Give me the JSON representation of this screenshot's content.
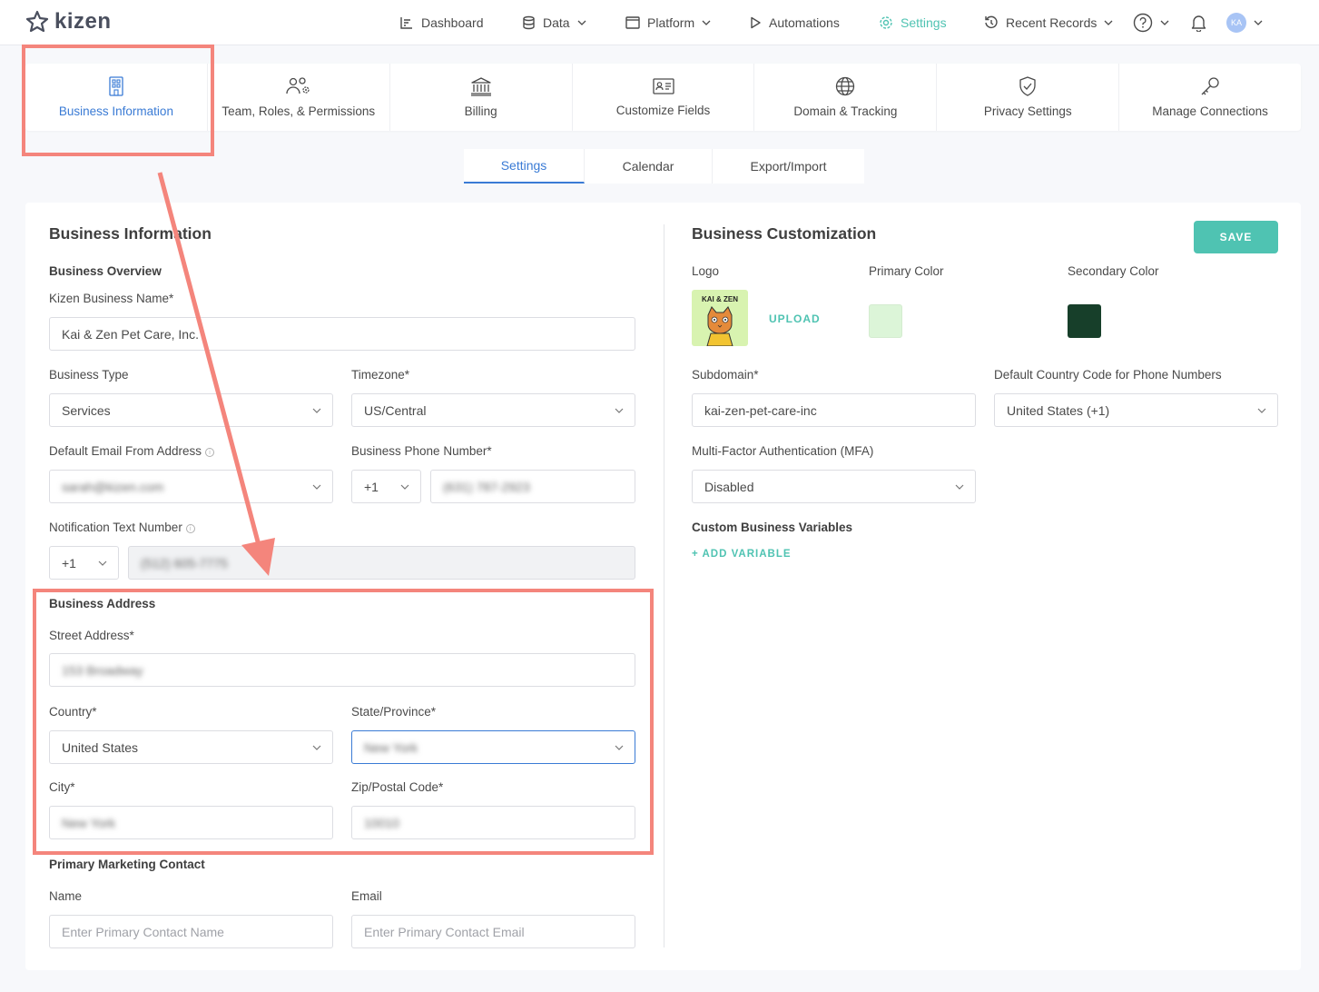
{
  "app": {
    "name": "kizen"
  },
  "topnav": {
    "items": [
      {
        "label": "Dashboard"
      },
      {
        "label": "Data"
      },
      {
        "label": "Platform"
      },
      {
        "label": "Automations"
      },
      {
        "label": "Settings"
      },
      {
        "label": "Recent Records"
      }
    ],
    "avatar_initials": "KA"
  },
  "tiles": [
    {
      "label": "Business Information",
      "icon": "building-icon"
    },
    {
      "label": "Team, Roles, & Permissions",
      "icon": "users-gear-icon"
    },
    {
      "label": "Billing",
      "icon": "bank-icon"
    },
    {
      "label": "Customize Fields",
      "icon": "id-card-icon"
    },
    {
      "label": "Domain & Tracking",
      "icon": "globe-icon"
    },
    {
      "label": "Privacy Settings",
      "icon": "shield-check-icon"
    },
    {
      "label": "Manage Connections",
      "icon": "key-icon"
    }
  ],
  "subtabs": [
    {
      "label": "Settings"
    },
    {
      "label": "Calendar"
    },
    {
      "label": "Export/Import"
    }
  ],
  "left": {
    "title": "Business Information",
    "overview_heading": "Business Overview",
    "business_name_label": "Kizen Business Name*",
    "business_name_value": "Kai & Zen Pet Care, Inc.",
    "business_type_label": "Business Type",
    "business_type_value": "Services",
    "timezone_label": "Timezone*",
    "timezone_value": "US/Central",
    "email_from_label": "Default Email From Address",
    "email_from_value": "sarah@kizen.com",
    "phone_label": "Business Phone Number*",
    "phone_code": "+1",
    "phone_value": "(631) 787-2923",
    "notif_label": "Notification Text Number",
    "notif_code": "+1",
    "notif_value": "(512) 605-7775",
    "address_heading": "Business Address",
    "street_label": "Street Address*",
    "street_value": "153 Broadway",
    "country_label": "Country*",
    "country_value": "United States",
    "state_label": "State/Province*",
    "state_value": "New York",
    "city_label": "City*",
    "city_value": "New York",
    "zip_label": "Zip/Postal Code*",
    "zip_value": "10010",
    "marketing_heading": "Primary Marketing Contact",
    "name_label": "Name",
    "name_placeholder": "Enter Primary Contact Name",
    "email_label": "Email",
    "email_placeholder": "Enter Primary Contact Email"
  },
  "right": {
    "title": "Business Customization",
    "save_label": "SAVE",
    "logo_label": "Logo",
    "logo_text": "KAI & ZEN",
    "upload_label": "UPLOAD",
    "primary_color_label": "Primary Color",
    "primary_color": "#dcf5d8",
    "secondary_color_label": "Secondary Color",
    "secondary_color": "#173f2a",
    "subdomain_label": "Subdomain*",
    "subdomain_value": "kai-zen-pet-care-inc",
    "country_code_label": "Default Country Code for Phone Numbers",
    "country_code_value": "United States (+1)",
    "mfa_label": "Multi-Factor Authentication (MFA)",
    "mfa_value": "Disabled",
    "variables_heading": "Custom Business Variables",
    "add_variable_label": "+ ADD VARIABLE"
  },
  "colors": {
    "accent": "#4fc3b2",
    "active_blue": "#3a7bd5",
    "annotation": "#f4857c"
  }
}
